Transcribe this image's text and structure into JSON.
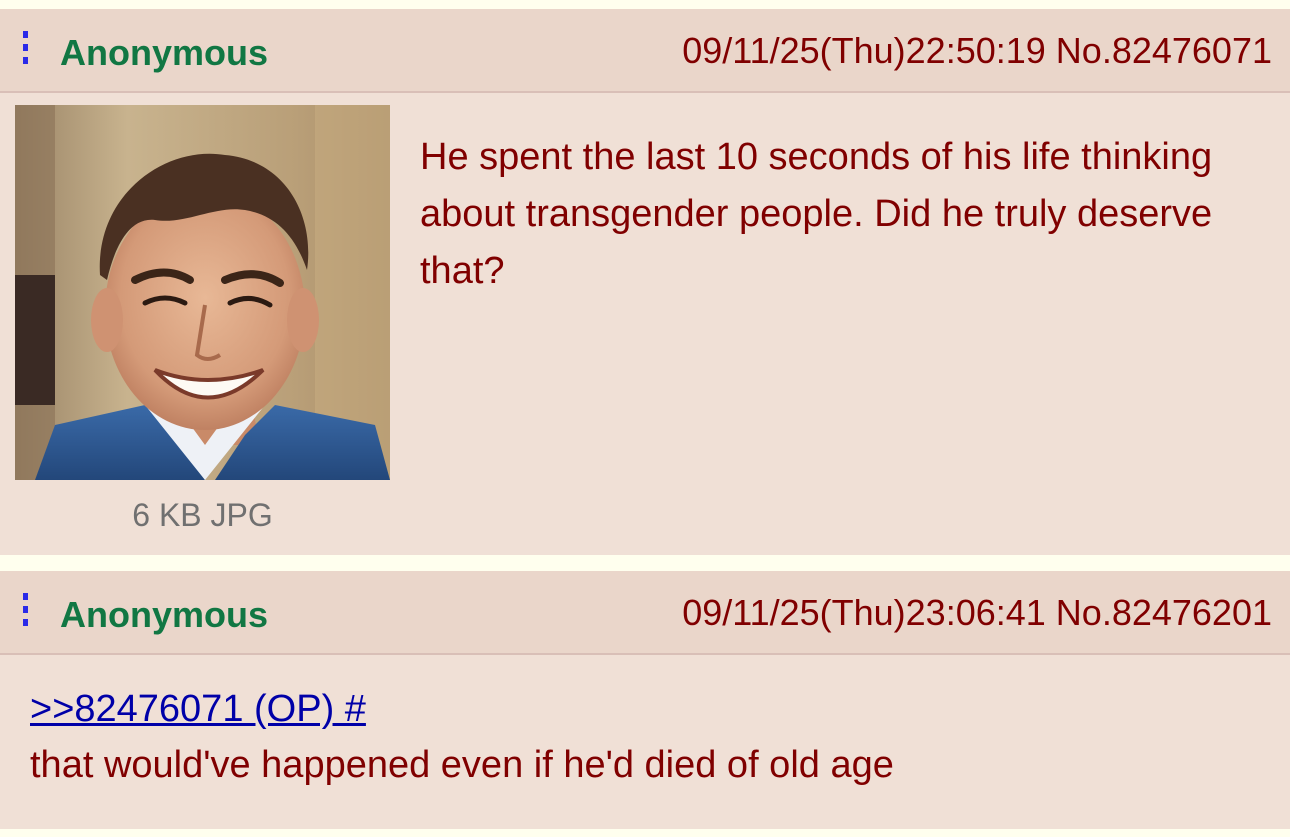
{
  "thread": {
    "op": {
      "author": "Anonymous",
      "datetime": "09/11/25(Thu)22:50:19",
      "post_number": "No.82476071",
      "file_info": "6 KB JPG",
      "thumbnail_icon": "photo-thumbnail",
      "body": "He spent the last 10 seconds of his life thinking about transgender people. Did he truly deserve that?"
    },
    "reply": {
      "author": "Anonymous",
      "datetime": "09/11/25(Thu)23:06:41",
      "post_number": "No.82476201",
      "quote_link": ">>82476071 (OP) #",
      "body": "that would've happened even if he'd died of old age"
    }
  },
  "colors": {
    "page_background": "#ffffee",
    "post_background": "#f0e0d6",
    "header_background": "#ead6ca",
    "author_green": "#117743",
    "text_maroon": "#800000",
    "link_blue": "#0000a8",
    "menu_icon_blue": "#2a2ae8"
  }
}
